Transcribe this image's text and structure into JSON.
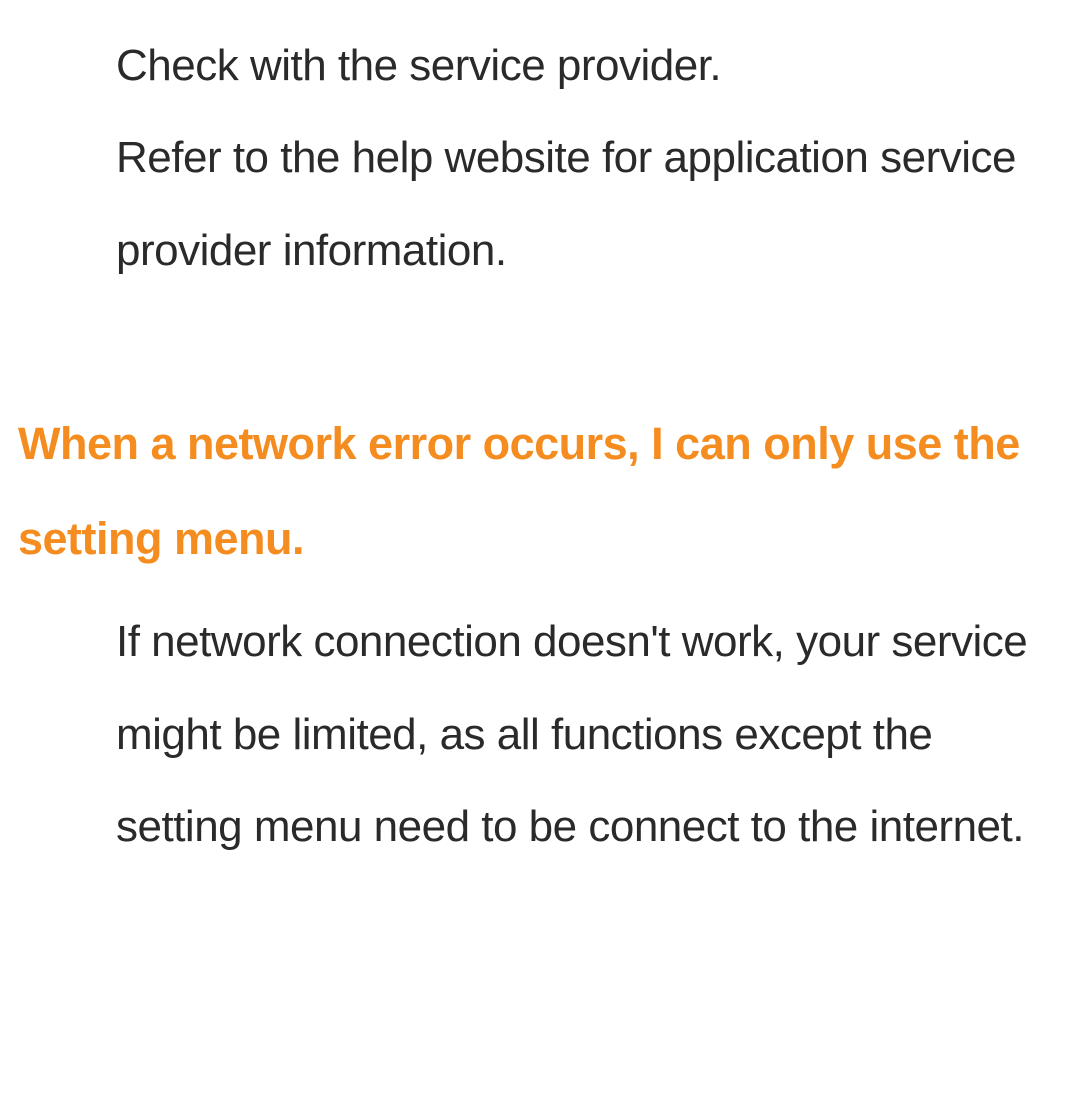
{
  "section1": {
    "paragraph1": "Check with the service provider.",
    "paragraph2": "Refer to the help website for application service provider information."
  },
  "section2": {
    "heading": "When a network error occurs, I can only use the setting menu.",
    "paragraph1": "If network connection doesn't work, your service might be limited, as all functions except the setting menu need to be connect to the internet."
  }
}
